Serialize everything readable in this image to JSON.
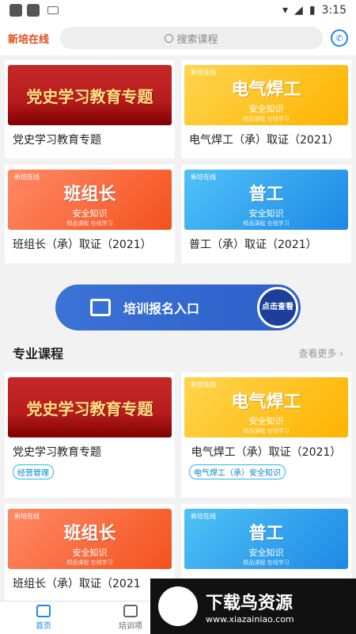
{
  "status": {
    "time": "3:15"
  },
  "header": {
    "logo": "新培在线",
    "search_placeholder": "搜索课程",
    "phone_icon": "phone-icon"
  },
  "top_courses": [
    {
      "title": "党史学习教育专题",
      "thumb_big": "党史学习教育专题",
      "thumb_sub": "",
      "style": "red"
    },
    {
      "title": "电气焊工（承）取证（2021）",
      "thumb_big": "电气焊工",
      "thumb_sub": "安全知识",
      "tiny": "新培在线",
      "foot": "精品课程 在线学习",
      "style": "yellow"
    },
    {
      "title": "班组长（承）取证（2021）",
      "thumb_big": "班组长",
      "thumb_sub": "安全知识",
      "tiny": "新培在线",
      "foot": "精品课程 在线学习",
      "style": "orange"
    },
    {
      "title": "普工（承）取证（2021）",
      "thumb_big": "普工",
      "thumb_sub": "安全知识",
      "tiny": "新培在线",
      "foot": "精品课程 在线学习",
      "style": "blue"
    }
  ],
  "banner": {
    "text": "培训报名入口",
    "button": "点击查看"
  },
  "section": {
    "title": "专业课程",
    "more": "查看更多 ›"
  },
  "pro_courses": [
    {
      "title": "党史学习教育专题",
      "tag": "经营管理",
      "thumb_big": "党史学习教育专题",
      "style": "red"
    },
    {
      "title": "电气焊工（承）取证（2021）",
      "tag": "电气焊工（承）安全知识",
      "thumb_big": "电气焊工",
      "thumb_sub": "安全知识",
      "tiny": "新培在线",
      "foot": "精品课程 在线学习",
      "style": "yellow"
    },
    {
      "title": "班组长（承）取证（2021",
      "thumb_big": "班组长",
      "thumb_sub": "安全知识",
      "tiny": "新培在线",
      "foot": "精品课程 在线学习",
      "style": "orange"
    },
    {
      "title": "",
      "thumb_big": "普工",
      "thumb_sub": "安全知识",
      "tiny": "新培在线",
      "foot": "精品课程 在线学习",
      "style": "blue"
    }
  ],
  "nav": [
    {
      "label": "首页",
      "icon": "home-icon",
      "active": true
    },
    {
      "label": "培训项",
      "icon": "book-icon",
      "active": false
    }
  ],
  "watermark": {
    "title": "下载鸟资源",
    "url": "www.xiazainiao.com"
  }
}
